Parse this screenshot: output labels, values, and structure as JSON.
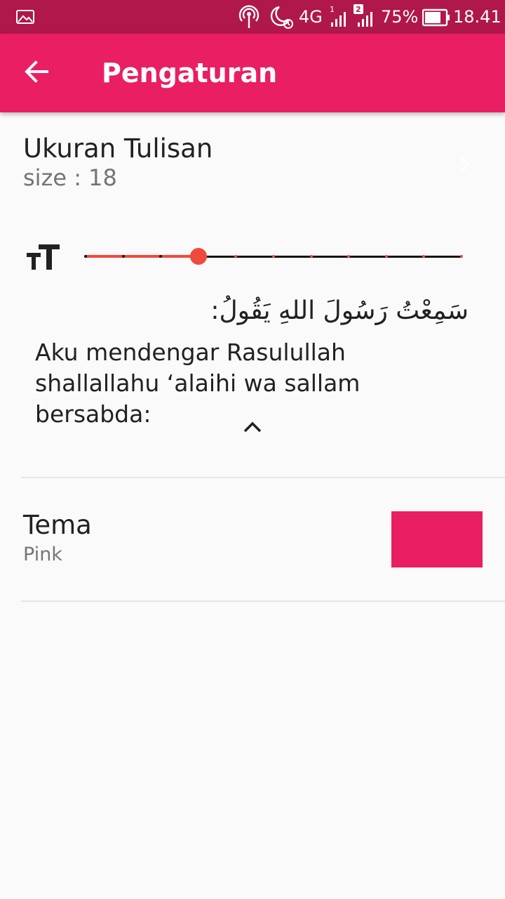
{
  "status_bar": {
    "battery": "75%",
    "time": "18.41",
    "network": "4G",
    "sim1_badge": "1",
    "sim2_badge": "2",
    "icons": [
      "gallery-icon",
      "hotspot-icon",
      "night-alarm-icon",
      "signal-icon",
      "signal-icon",
      "battery-icon"
    ]
  },
  "app_bar": {
    "title": "Pengaturan",
    "background": "#e91e63",
    "back_icon": "arrow-back-icon"
  },
  "font_size_setting": {
    "title": "Ukuran Tulisan",
    "subtitle": "size : 18",
    "slider": {
      "steps": 10,
      "selected_index": 3,
      "active_color": "#ef4a3c"
    },
    "preview_arabic": "سَمِعْتُ رَسُولَ اللهِ يَقُولُ:",
    "preview_translation": "Aku mendengar Rasulullah shallallahu ‘alaihi wa sallam bersabda:"
  },
  "theme_setting": {
    "title": "Tema",
    "subtitle": "Pink",
    "swatch_color": "#e91e63"
  }
}
